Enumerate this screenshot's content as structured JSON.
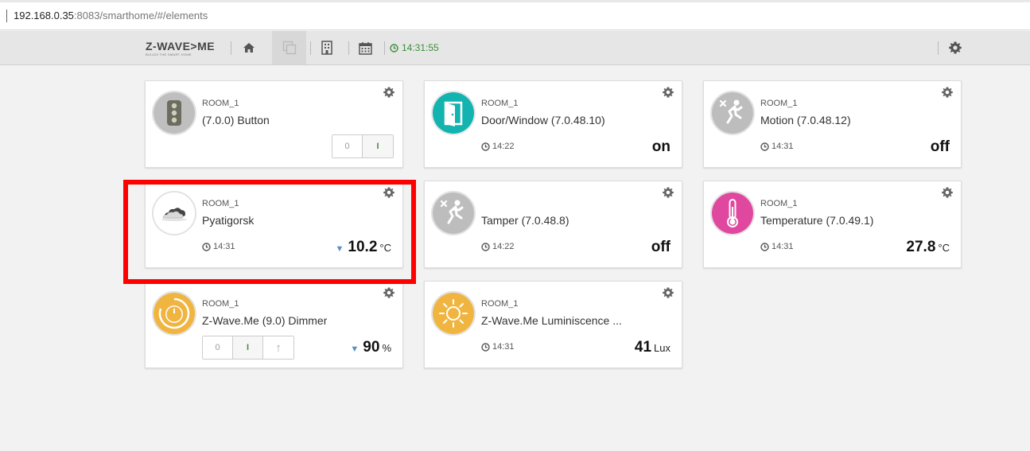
{
  "browser": {
    "url_host": "192.168.0.35",
    "url_rest": ":8083/smarthome/#/elements"
  },
  "navbar": {
    "logo_text": "Z-WAVE>ME",
    "logo_tagline": "BUILDS THE SMART HOME",
    "clock": "14:31:55"
  },
  "elements": [
    {
      "room": "ROOM_1",
      "title": "(7.0.0) Button",
      "toggle": [
        "0",
        "I"
      ]
    },
    {
      "room": "ROOM_1",
      "title": "Door/Window (7.0.48.10)",
      "time": "14:22",
      "value": "on"
    },
    {
      "room": "ROOM_1",
      "title": "Motion (7.0.48.12)",
      "time": "14:31",
      "value": "off"
    },
    {
      "room": "ROOM_1",
      "title": "Pyatigorsk",
      "time": "14:31",
      "value": "10.2",
      "unit": "°C"
    },
    {
      "room": "",
      "title": "Tamper (7.0.48.8)",
      "time": "14:22",
      "value": "off"
    },
    {
      "room": "ROOM_1",
      "title": "Temperature (7.0.49.1)",
      "time": "14:31",
      "value": "27.8",
      "unit": "°C"
    },
    {
      "room": "ROOM_1",
      "title": "Z-Wave.Me (9.0) Dimmer",
      "toggle": [
        "0",
        "I",
        "↑"
      ],
      "value": "90",
      "unit": "%"
    },
    {
      "room": "ROOM_1",
      "title": "Z-Wave.Me Luminiscence ...",
      "time": "14:31",
      "value": "41",
      "unit": "Lux"
    }
  ],
  "colors": {
    "teal": "#13b3b0",
    "pink": "#e0479e",
    "yellow": "#f0b540",
    "gray_icon": "#bdbdbd",
    "highlight": "#ff0000"
  }
}
